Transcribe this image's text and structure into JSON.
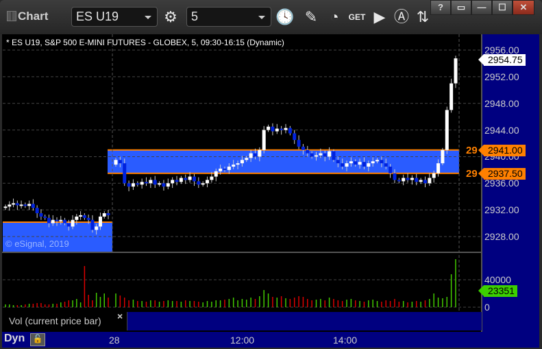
{
  "window": {
    "title": "Chart",
    "help": "?",
    "restore_down": "▭",
    "minimize": "—",
    "maximize": "☐",
    "close": "✕"
  },
  "toolbar": {
    "symbol": "ES U19",
    "interval": "5",
    "icons": [
      "gear-icon",
      "clock-icon",
      "pencil-icon",
      "study-icon",
      "get-icon",
      "play-icon",
      "alert-icon",
      "link-icon"
    ],
    "get_label": "GET"
  },
  "chart": {
    "header": "* ES U19, S&P 500 E-MINI FUTURES - GLOBEX, 5, 09:30-16:15 (Dynamic)",
    "watermark": "© eSignal, 2019",
    "price_labels": [
      "2956.00",
      "2952.00",
      "2948.00",
      "2944.00",
      "2940.00",
      "2936.00",
      "2932.00",
      "2928.00"
    ],
    "current_price": "2954.75",
    "level_high": "2941.00",
    "level_low": "2937.50",
    "level_left_high": "29",
    "level_left_low": "29",
    "volume_labels": [
      "40000",
      "0"
    ],
    "current_volume": "23351",
    "study_label": "Vol (current price bar)",
    "study_close": "×",
    "x_labels": [
      "28",
      "12:00",
      "14:00"
    ],
    "footer_mode": "Dyn"
  },
  "colors": {
    "band": "#2a5cff",
    "level": "#ff8000",
    "up": "#ffffff",
    "down": "#0022dd",
    "vol_up": "#44cc00",
    "vol_down": "#dd0000",
    "axis": "#000080"
  },
  "chart_data": {
    "type": "candlestick",
    "ylim": [
      2925.6,
      2958.3
    ],
    "prior_closes": [
      2932.5,
      2932.8,
      2933,
      2932.7,
      2932.8,
      2932.6,
      2932.9,
      2932.3,
      2931.5,
      2931,
      2930.8,
      2930,
      2930.5,
      2930.3,
      2930.5,
      2930,
      2929.5,
      2930.5,
      2931,
      2931.2,
      2930.8,
      2930.5,
      2929,
      2929.5,
      2931,
      2931.5,
      2931.2
    ],
    "today_closes": [
      2939.5,
      2939,
      2936,
      2935.5,
      2936,
      2935.8,
      2936.2,
      2936,
      2936.5,
      2935.8,
      2936,
      2935.5,
      2936,
      2936.5,
      2936.2,
      2936.8,
      2936.5,
      2937,
      2936.3,
      2935.8,
      2936,
      2936.5,
      2937,
      2937.8,
      2938.2,
      2938,
      2938.5,
      2938.8,
      2939,
      2939.5,
      2939.8,
      2940.5,
      2940,
      2941,
      2944,
      2944.5,
      2943.8,
      2944.2,
      2944,
      2944.3,
      2943.5,
      2942.5,
      2941.5,
      2941,
      2940.5,
      2940,
      2940.2,
      2940.5,
      2940,
      2940.8,
      2939.5,
      2939,
      2938.5,
      2939,
      2939.3,
      2938.8,
      2939.2,
      2938.5,
      2939,
      2939.3,
      2939.5,
      2939,
      2938.5,
      2937.5,
      2936.5,
      2936.3,
      2936.8,
      2936.5,
      2936.8,
      2936.2,
      2936.5,
      2936,
      2936.8,
      2937.5,
      2939,
      2941,
      2947,
      2951,
      2954.75
    ],
    "prior_volume": [
      4,
      4,
      3,
      3,
      3,
      4,
      5,
      5,
      6,
      6,
      4,
      4,
      5,
      5,
      7,
      8,
      10,
      10,
      12,
      7,
      60,
      18,
      10,
      21,
      15,
      20,
      14
    ],
    "today_volume": [
      20,
      17,
      14,
      10,
      11,
      9,
      9,
      8,
      10,
      10,
      8,
      9,
      10,
      9,
      9,
      8,
      10,
      9,
      9,
      8,
      7,
      9,
      8,
      10,
      10,
      11,
      12,
      14,
      10,
      12,
      11,
      14,
      12,
      16,
      25,
      20,
      15,
      14,
      16,
      13,
      12,
      14,
      16,
      15,
      12,
      10,
      11,
      12,
      10,
      14,
      12,
      10,
      9,
      11,
      12,
      10,
      9,
      8,
      10,
      11,
      9,
      8,
      10,
      9,
      12,
      8,
      9,
      7,
      8,
      9,
      8,
      10,
      12,
      20,
      14,
      13,
      15,
      48,
      70,
      48,
      28,
      26
    ]
  }
}
